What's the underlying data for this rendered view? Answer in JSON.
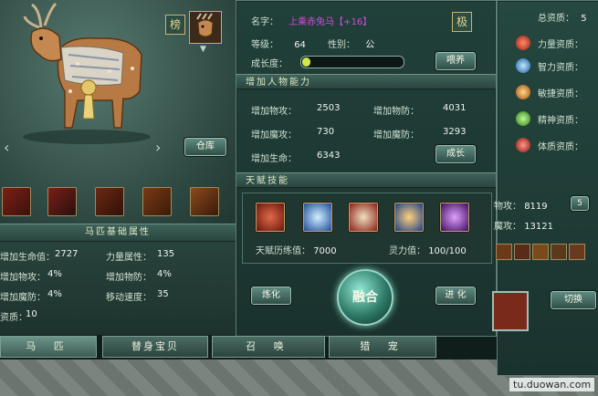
{
  "pet": {
    "name_label": "名字：",
    "name": "上乘赤兔马【+16】",
    "level_label": "等级：",
    "level": "64",
    "gender_label": "性别：",
    "gender": "公",
    "growth_label": "成长度：",
    "growth_fraction": 0.08
  },
  "badges": {
    "rank": "榜",
    "extreme": "极"
  },
  "buttons": {
    "feed": "喂养",
    "warehouse": "仓库",
    "grow": "成长",
    "refine": "炼化",
    "fuse": "融合",
    "advance": "进 化",
    "switch": "切换",
    "small_a": "5"
  },
  "add_power": {
    "title": "增加人物能力",
    "rows": [
      {
        "l1": "增加物攻：",
        "v1": "2503",
        "l2": "增加物防：",
        "v2": "4031"
      },
      {
        "l1": "增加魔攻：",
        "v1": "730",
        "l2": "增加魔防：",
        "v2": "3293"
      },
      {
        "l1": "增加生命：",
        "v1": "6343"
      }
    ]
  },
  "talent": {
    "title": "天赋技能",
    "exp_label": "天赋历练值：",
    "exp_value": "7000",
    "spirit_label": "灵力值：",
    "spirit_value": "100/100"
  },
  "base": {
    "title": "马匹基础属性",
    "rows": [
      {
        "l1": "增加生命值：",
        "v1": "2727",
        "l2": "力量属性：",
        "v2": "135"
      },
      {
        "l1": "增加物攻：",
        "v1": "4%",
        "l2": "增加物防：",
        "v2": "4%"
      },
      {
        "l1": "增加魔防：",
        "v1": "4%",
        "l2": "移动速度：",
        "v2": "35"
      },
      {
        "l1": "资质：",
        "v1": "10"
      }
    ]
  },
  "tabs": [
    "马 匹",
    "替身宝贝",
    "召 唤",
    "猎 宠"
  ],
  "right": {
    "header_label": "总资质：",
    "header_value": "5",
    "rows": [
      "力量资质：",
      "智力资质：",
      "敏捷资质：",
      "精神资质：",
      "体质资质："
    ],
    "stats": [
      {
        "label": "物攻",
        "value": "8119"
      },
      {
        "label": "魔攻",
        "value": "13121"
      }
    ]
  },
  "watermark": "tu.duowan.com",
  "colors": {
    "pet_name": "#d04bd8",
    "panel": "#22413b",
    "accent_gold": "#d6c06a",
    "growth_bar": "#d2e84a"
  }
}
